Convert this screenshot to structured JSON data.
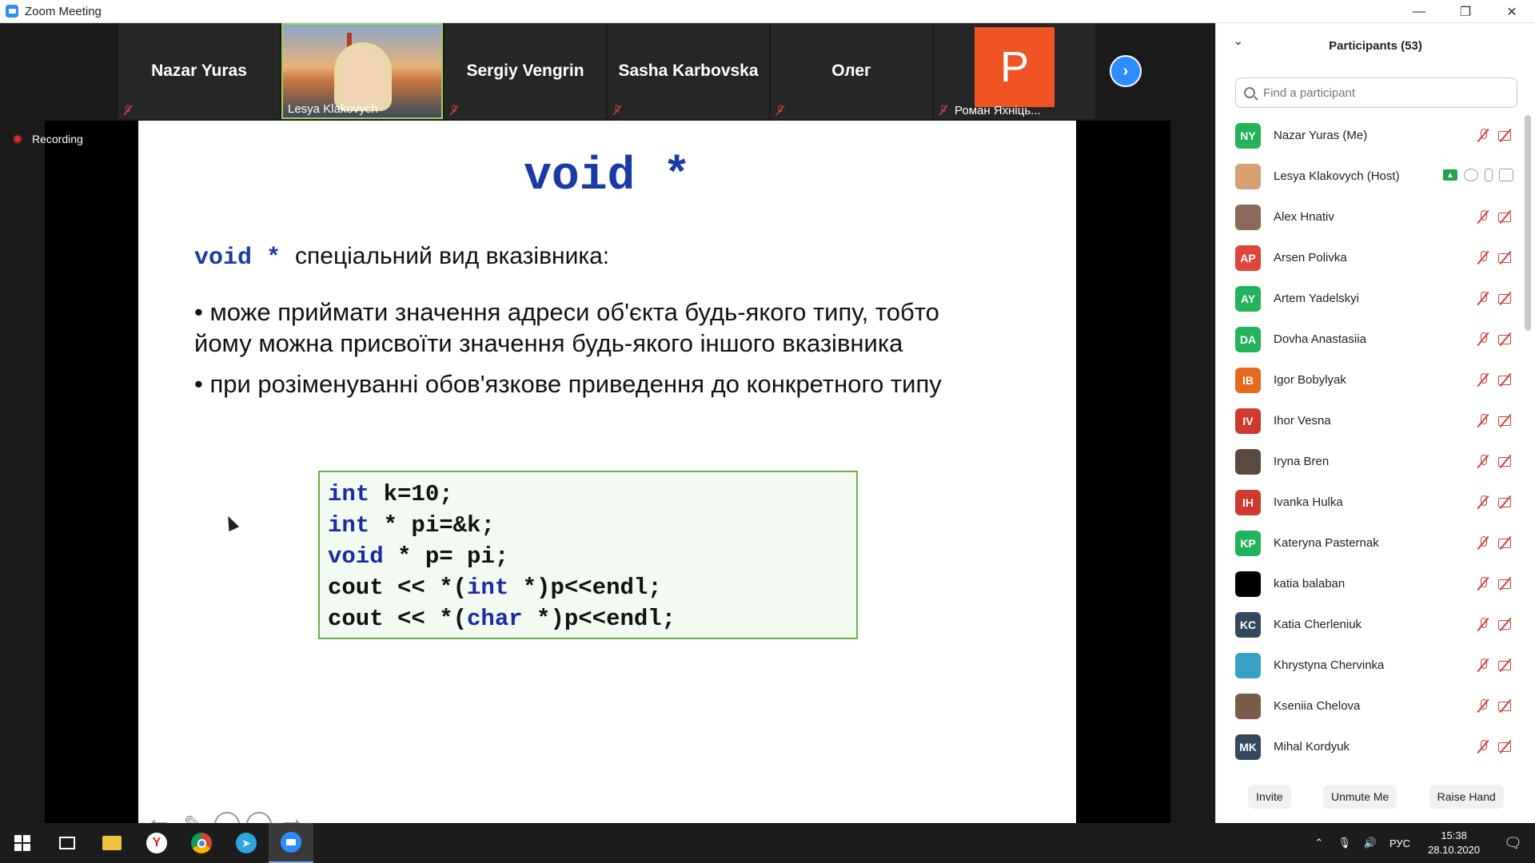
{
  "window": {
    "title": "Zoom Meeting",
    "minimize": "—",
    "restore": "❐",
    "close": "✕"
  },
  "gallery": {
    "tiles": [
      {
        "name": "Nazar Yuras"
      },
      {
        "name": "Lesya Klakovych"
      },
      {
        "name": "Sergiy Vengrin"
      },
      {
        "name": "Sasha Karbovska"
      },
      {
        "name": "Олег"
      },
      {
        "name": "Роман Яхніць...",
        "avatar_letter": "P"
      }
    ],
    "next": "›"
  },
  "recording": {
    "label": "Recording"
  },
  "slide": {
    "title": "void  *",
    "keyword": "void *",
    "intro": "спеціальний вид вказівника:",
    "bullets": [
      "• може приймати значення адреси об'єкта будь-якого типу, тобто йому можна присвоїти значення будь-якого іншого вказівника",
      "• при розіменуванні обов'язкове приведення до конкретного типу"
    ],
    "code": [
      {
        "kw": "int",
        "rest": " k=10;"
      },
      {
        "kw": "int",
        "rest": " * pi=&k;"
      },
      {
        "kw": "void",
        "rest": " * p= pi;"
      },
      {
        "pre": "cout << *(",
        "kw": "int",
        "rest": " *)p<<endl;"
      },
      {
        "pre": "cout << *(",
        "kw": "char",
        "rest": " *)p<<endl;"
      }
    ]
  },
  "participants": {
    "header": "Participants (53)",
    "search_placeholder": "Find a participant",
    "list": [
      {
        "initials": "NY",
        "name": "Nazar Yuras (Me)",
        "color": "#23b35a"
      },
      {
        "initials": "",
        "name": "Lesya Klakovych (Host)",
        "color": "#d8a070",
        "host": true
      },
      {
        "initials": "",
        "name": "Alex Hnativ",
        "color": "#8a6a5a"
      },
      {
        "initials": "AP",
        "name": "Arsen Polivka",
        "color": "#e0453a"
      },
      {
        "initials": "AY",
        "name": "Artem Yadelskyi",
        "color": "#23b35a"
      },
      {
        "initials": "DA",
        "name": "Dovha Anastasiia",
        "color": "#23b35a"
      },
      {
        "initials": "IB",
        "name": "Igor Bobylyak",
        "color": "#e56a1e"
      },
      {
        "initials": "IV",
        "name": "Ihor Vesna",
        "color": "#d03a2e"
      },
      {
        "initials": "",
        "name": "Iryna Bren",
        "color": "#5a4a40"
      },
      {
        "initials": "IH",
        "name": "Ivanka Hulka",
        "color": "#d03a2e"
      },
      {
        "initials": "KP",
        "name": "Kateryna Pasternak",
        "color": "#23b35a"
      },
      {
        "initials": "",
        "name": "katia balaban",
        "color": "#000000"
      },
      {
        "initials": "KC",
        "name": "Katia Cherleniuk",
        "color": "#34495e"
      },
      {
        "initials": "",
        "name": "Khrystyna Chervinka",
        "color": "#3aa0c8"
      },
      {
        "initials": "",
        "name": "Kseniia Chelova",
        "color": "#7a5a4a"
      },
      {
        "initials": "MK",
        "name": "Mihal Kordyuk",
        "color": "#34495e"
      }
    ],
    "buttons": {
      "invite": "Invite",
      "unmute": "Unmute Me",
      "raise": "Raise Hand"
    }
  },
  "taskbar": {
    "lang": "РУС",
    "time": "15:38",
    "date": "28.10.2020"
  }
}
